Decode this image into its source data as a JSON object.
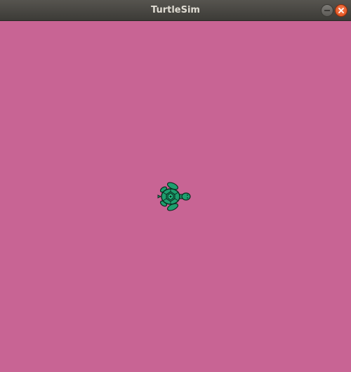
{
  "window": {
    "title": "TurtleSim",
    "buttons": {
      "minimize_icon": "minimize-icon",
      "close_icon": "close-icon"
    }
  },
  "canvas": {
    "background_color": "#c86494",
    "turtle": {
      "icon": "turtle-icon",
      "heading": "east",
      "body_color": "#1e9e6e",
      "outline_color": "#0b2b1e"
    }
  }
}
